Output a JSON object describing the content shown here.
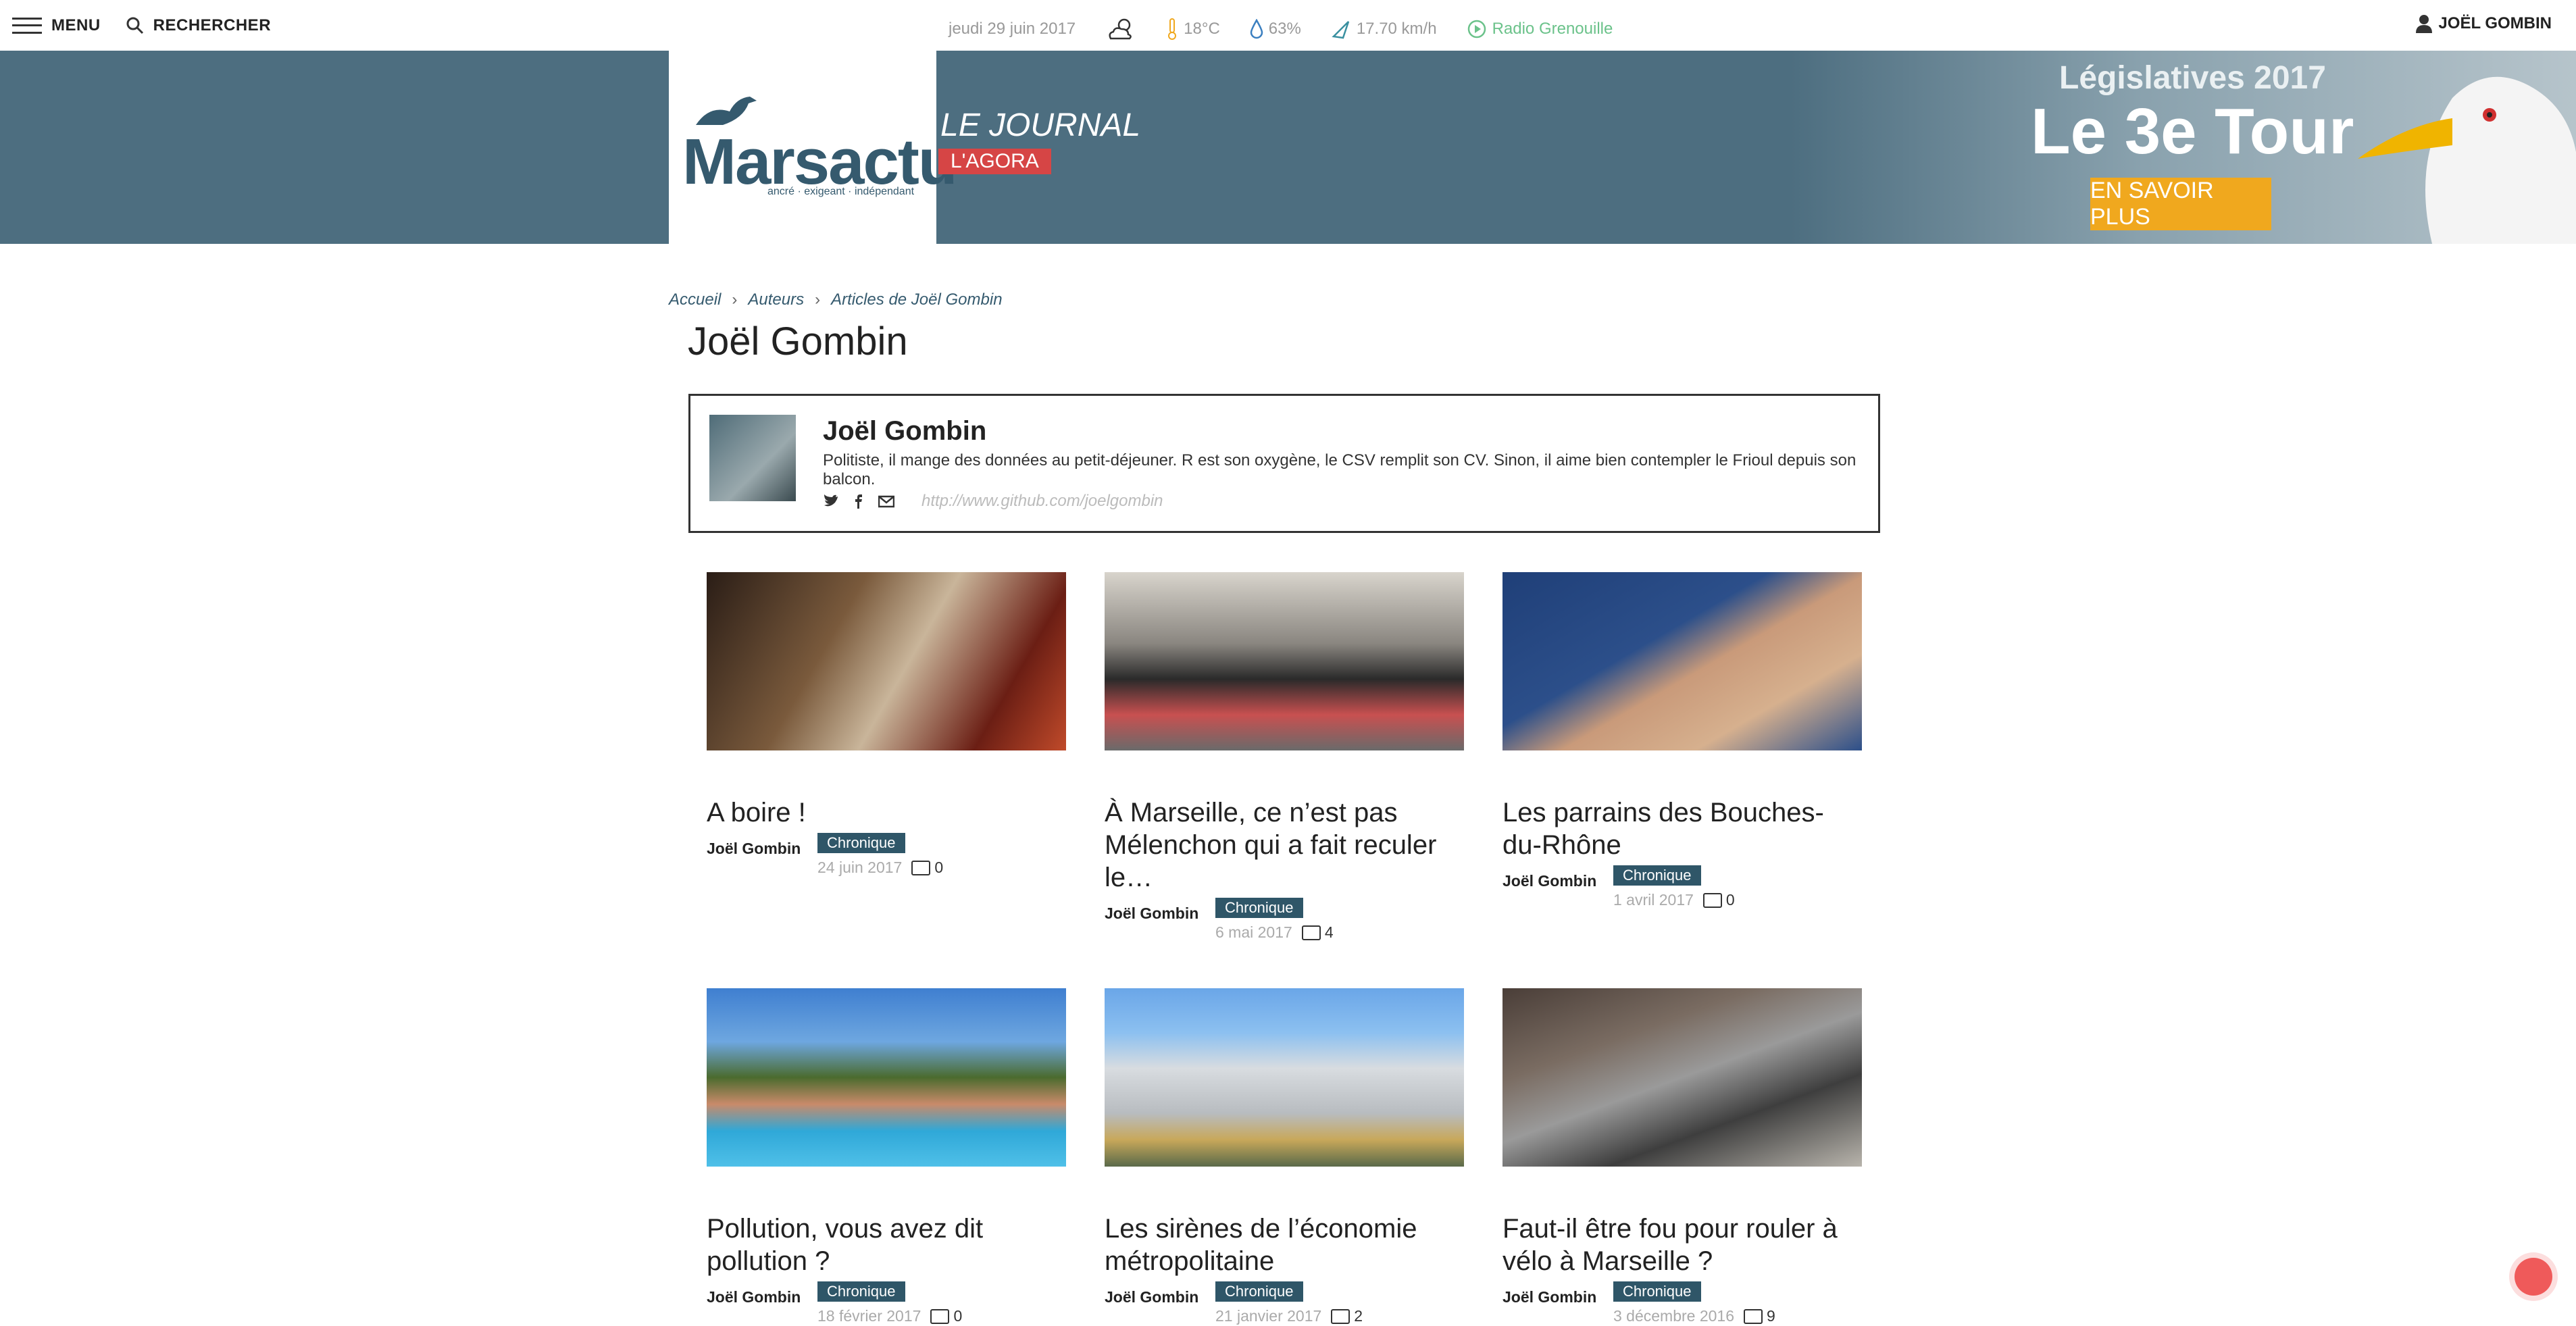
{
  "topbar": {
    "menu_label": "MENU",
    "search_label": "RECHERCHER",
    "date": "jeudi 29 juin 2017",
    "temperature": "18°C",
    "humidity": "63%",
    "wind": "17.70 km/h",
    "radio": "Radio Grenouille",
    "user": "JOËL GOMBIN"
  },
  "header": {
    "logo": "Marsactu",
    "logo_tagline": "ancré · exigeant · indépendant",
    "journal_label": "LE JOURNAL",
    "agora_label": "L'AGORA",
    "promo_small": "Législatives 2017",
    "promo_big": "Le 3e Tour",
    "promo_button": "EN SAVOIR PLUS"
  },
  "breadcrumb": [
    "Accueil",
    "Auteurs",
    "Articles de Joël Gombin"
  ],
  "page_title": "Joël Gombin",
  "author": {
    "name": "Joël Gombin",
    "bio": "Politiste, il mange des données au petit-déjeuner. R est son oxygène, le CSV remplit son CV. Sinon, il aime bien contempler le Frioul depuis son balcon.",
    "url": "http://www.github.com/joelgombin"
  },
  "articles": [
    {
      "title": "A boire !",
      "author": "Joël Gombin",
      "category": "Chronique",
      "date": "24 juin 2017",
      "comments": "0"
    },
    {
      "title": "À Marseille, ce n’est pas Mélenchon qui a fait reculer le…",
      "author": "Joël Gombin",
      "category": "Chronique",
      "date": "6 mai 2017",
      "comments": "4"
    },
    {
      "title": "Les parrains des Bouches-du-Rhône",
      "author": "Joël Gombin",
      "category": "Chronique",
      "date": "1 avril 2017",
      "comments": "0"
    },
    {
      "title": "Pollution, vous avez dit pollution ?",
      "author": "Joël Gombin",
      "category": "Chronique",
      "date": "18 février 2017",
      "comments": "0"
    },
    {
      "title": "Les sirènes de l’économie métropolitaine",
      "author": "Joël Gombin",
      "category": "Chronique",
      "date": "21 janvier 2017",
      "comments": "2"
    },
    {
      "title": "Faut-il être fou pour rouler à vélo à Marseille ?",
      "author": "Joël Gombin",
      "category": "Chronique",
      "date": "3 décembre 2016",
      "comments": "9"
    }
  ],
  "colors": {
    "brand": "#4d6e80",
    "badge": "#2f5668",
    "agora": "#d64545",
    "promo_button": "#f0a81e"
  }
}
